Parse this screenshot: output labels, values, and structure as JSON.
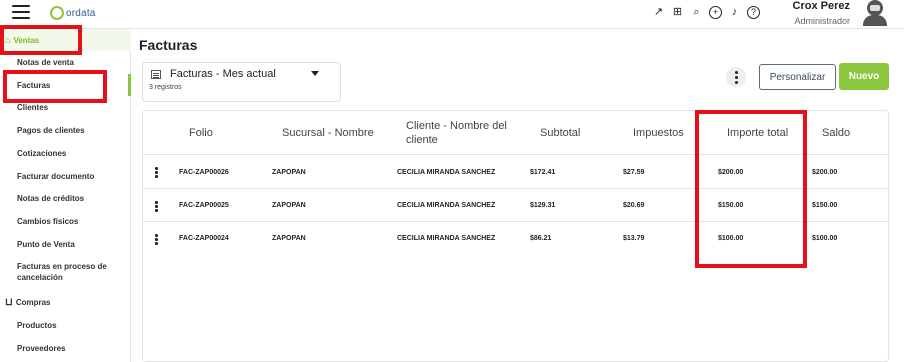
{
  "app": {
    "logo_text": "ordata"
  },
  "topbar": {
    "icons": [
      "external-link-icon",
      "gift-icon",
      "search-icon",
      "add-icon",
      "bell-icon",
      "help-icon"
    ],
    "user_name": "Crox Perez",
    "user_role": "Administrador"
  },
  "sidebar": {
    "groups": [
      {
        "label": "Ventas",
        "icon": "store-icon",
        "active": true
      },
      {
        "label": "Compras",
        "icon": "cart-icon",
        "active": false
      }
    ],
    "ventas_items": [
      {
        "label": "Notas de venta"
      },
      {
        "label": "Facturas",
        "active": true
      },
      {
        "label": "Clientes"
      },
      {
        "label": "Pagos de clientes"
      },
      {
        "label": "Cotizaciones"
      },
      {
        "label": "Facturar documento"
      },
      {
        "label": "Notas de créditos"
      },
      {
        "label": "Cambios físicos"
      },
      {
        "label": "Punto de Venta"
      },
      {
        "label": "Facturas en proceso de cancelación"
      }
    ],
    "compras_items": [
      {
        "label": "Productos"
      },
      {
        "label": "Proveedores"
      }
    ]
  },
  "main": {
    "title": "Facturas",
    "view_selector": {
      "label": "Facturas - Mes actual",
      "count": "3 registros"
    },
    "buttons": {
      "customize": "Personalizar",
      "new": "Nuevo"
    },
    "table": {
      "columns": [
        "Folio",
        "Sucursal - Nombre",
        "Cliente - Nombre del cliente",
        "Subtotal",
        "Impuestos",
        "Importe total",
        "Saldo"
      ],
      "rows": [
        {
          "folio": "FAC-ZAP00026",
          "sucursal": "ZAPOPAN",
          "cliente": "CECILIA MIRANDA SANCHEZ",
          "subtotal": "$172.41",
          "impuestos": "$27.59",
          "importe_total": "$200.00",
          "saldo": "$200.00"
        },
        {
          "folio": "FAC-ZAP00025",
          "sucursal": "ZAPOPAN",
          "cliente": "CECILIA MIRANDA SANCHEZ",
          "subtotal": "$129.31",
          "impuestos": "$20.69",
          "importe_total": "$150.00",
          "saldo": "$150.00"
        },
        {
          "folio": "FAC-ZAP00024",
          "sucursal": "ZAPOPAN",
          "cliente": "CECILIA MIRANDA SANCHEZ",
          "subtotal": "$86.21",
          "impuestos": "$13.79",
          "importe_total": "$100.00",
          "saldo": "$100.00"
        }
      ]
    }
  },
  "colors": {
    "accent": "#8cc63f",
    "annotation": "#e5101a"
  }
}
